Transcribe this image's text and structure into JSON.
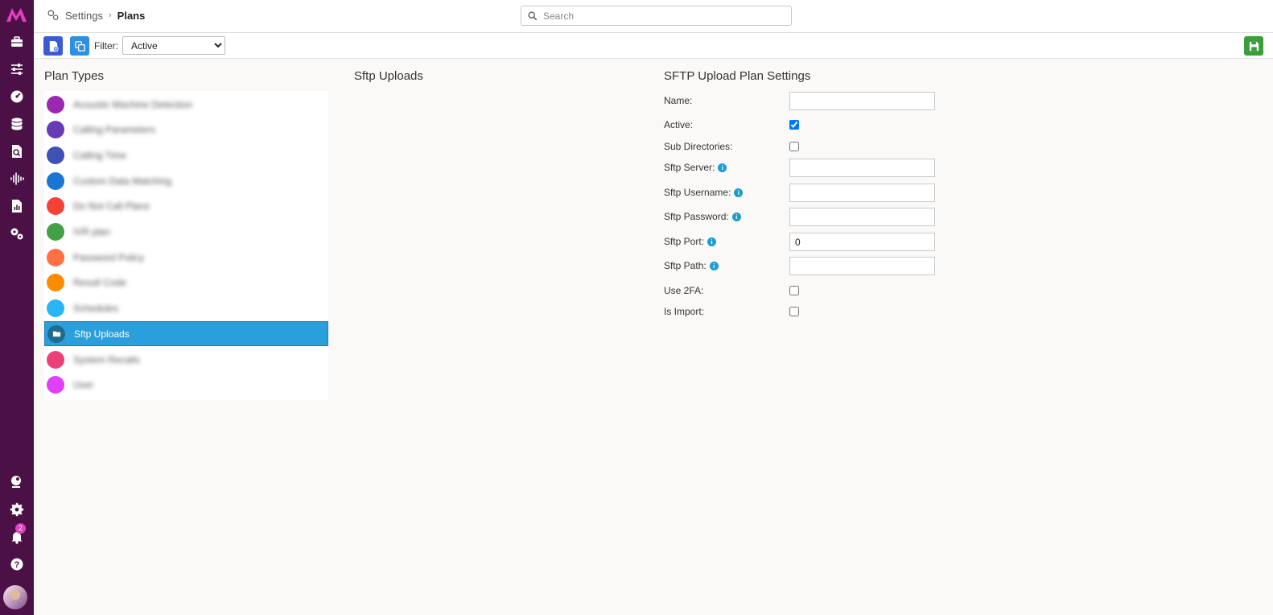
{
  "app": {
    "logo_text": "M"
  },
  "nav": {
    "items": [
      {
        "icon": "toolbox-icon"
      },
      {
        "icon": "sliders-icon"
      },
      {
        "icon": "dashboard-icon"
      },
      {
        "icon": "database-icon"
      },
      {
        "icon": "file-search-icon"
      },
      {
        "icon": "waveform-icon"
      },
      {
        "icon": "report-icon"
      },
      {
        "icon": "cogs-icon"
      }
    ],
    "bottom": {
      "notifications_count": "2"
    }
  },
  "breadcrumb": {
    "root": "Settings",
    "separator": "›",
    "current": "Plans"
  },
  "search": {
    "placeholder": "Search"
  },
  "toolbar": {
    "filter_label": "Filter:",
    "filter_value": "Active",
    "filter_options": [
      "Active"
    ]
  },
  "plan_types": {
    "title": "Plan Types",
    "items": [
      {
        "label": "Acoustic Machine Detection",
        "color": "#9c27b0"
      },
      {
        "label": "Calling Parameters",
        "color": "#673ab7"
      },
      {
        "label": "Calling Time",
        "color": "#3f51b5"
      },
      {
        "label": "Custom Data Matching",
        "color": "#1976d2"
      },
      {
        "label": "Do Not Call Plans",
        "color": "#f44336"
      },
      {
        "label": "IVR plan",
        "color": "#43a047"
      },
      {
        "label": "Password Policy",
        "color": "#ff7043"
      },
      {
        "label": "Result Code",
        "color": "#fb8c00"
      },
      {
        "label": "Schedules",
        "color": "#29b6f6"
      },
      {
        "label": "Sftp Uploads",
        "color": "#1e6c8e",
        "active": true
      },
      {
        "label": "System Recalls",
        "color": "#ec407a"
      },
      {
        "label": "User",
        "color": "#e040fb"
      }
    ]
  },
  "middle": {
    "title": "Sftp Uploads"
  },
  "settings": {
    "title": "SFTP Upload Plan Settings",
    "fields": {
      "name": {
        "label": "Name:",
        "value": ""
      },
      "active": {
        "label": "Active:",
        "checked": true
      },
      "sub_directories": {
        "label": "Sub Directories:",
        "checked": false
      },
      "sftp_server": {
        "label": "Sftp Server:",
        "value": ""
      },
      "sftp_username": {
        "label": "Sftp Username:",
        "value": ""
      },
      "sftp_password": {
        "label": "Sftp Password:",
        "value": ""
      },
      "sftp_port": {
        "label": "Sftp Port:",
        "value": "0"
      },
      "sftp_path": {
        "label": "Sftp Path:",
        "value": ""
      },
      "use_2fa": {
        "label": "Use 2FA:",
        "checked": false
      },
      "is_import": {
        "label": "Is Import:",
        "checked": false
      }
    }
  },
  "colors": {
    "sidebar": "#4b1146",
    "logo": "#e23fbf",
    "selected_item": "#2a9fdc",
    "save": "#3a9e3a",
    "new": "#3b5bd6",
    "copy": "#2f8fe0",
    "info": "#1a9dd1"
  }
}
